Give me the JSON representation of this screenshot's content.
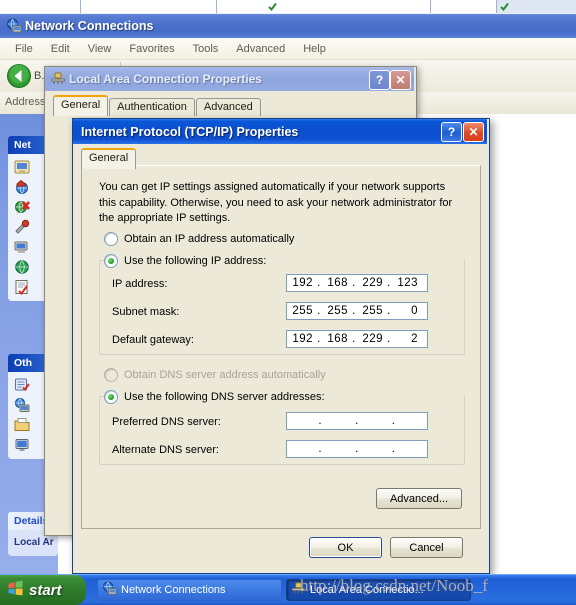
{
  "top_strip": {
    "segments": [
      "",
      "",
      "",
      ""
    ]
  },
  "explorer": {
    "title": "Network Connections",
    "icon": "network-globe-icon",
    "menu": [
      "File",
      "Edit",
      "View",
      "Favorites",
      "Tools",
      "Advanced",
      "Help"
    ],
    "toolbar": {
      "back_label": "B...",
      "back_icon": "back-arrow-icon"
    },
    "address_label": "Address",
    "sidebar": {
      "panels": [
        {
          "title": "Net",
          "full_title": "Network Tasks",
          "icons": [
            "new-connection-icon",
            "home-network-icon",
            "disable-device-icon",
            "repair-icon",
            "rename-icon",
            "view-status-icon",
            "change-settings-icon"
          ]
        },
        {
          "title": "Oth",
          "full_title": "Other Places",
          "icons": [
            "control-panel-icon",
            "my-network-places-icon",
            "my-documents-icon",
            "my-computer-icon"
          ]
        },
        {
          "title": "Details",
          "note": "Local Ar",
          "full_title": "Details"
        }
      ]
    }
  },
  "lac_dialog": {
    "title": "Local Area Connection Properties",
    "icon": "network-adapter-icon",
    "help_button": "?",
    "close_button": "✕",
    "tabs": [
      {
        "label": "General",
        "selected": true
      },
      {
        "label": "Authentication",
        "selected": false
      },
      {
        "label": "Advanced",
        "selected": false
      }
    ]
  },
  "ip_dialog": {
    "title": "Internet Protocol (TCP/IP) Properties",
    "help_button": "?",
    "close_button": "✕",
    "tabs": [
      {
        "label": "General",
        "selected": true
      }
    ],
    "description": "You can get IP settings assigned automatically if your network supports this capability. Otherwise, you need to ask your network administrator for the appropriate IP settings.",
    "ip_section": {
      "auto_option": "Obtain an IP address automatically",
      "manual_option": "Use the following IP address:",
      "selected": "manual",
      "fields": [
        {
          "label": "IP address:",
          "octets": [
            "192",
            "168",
            "229",
            "123"
          ]
        },
        {
          "label": "Subnet mask:",
          "octets": [
            "255",
            "255",
            "255",
            "0"
          ]
        },
        {
          "label": "Default gateway:",
          "octets": [
            "192",
            "168",
            "229",
            "2"
          ]
        }
      ]
    },
    "dns_section": {
      "auto_option": "Obtain DNS server address automatically",
      "auto_disabled": true,
      "manual_option": "Use the following DNS server addresses:",
      "selected": "manual",
      "fields": [
        {
          "label": "Preferred DNS server:",
          "octets": [
            "",
            "",
            "",
            ""
          ]
        },
        {
          "label": "Alternate DNS server:",
          "octets": [
            "",
            "",
            "",
            ""
          ]
        }
      ]
    },
    "advanced_button": "Advanced...",
    "ok_button": "OK",
    "cancel_button": "Cancel"
  },
  "taskbar": {
    "start_label": "start",
    "start_icon": "windows-flag-icon",
    "tasks": [
      {
        "label": "Network Connections",
        "icon": "network-globe-icon",
        "active": false
      },
      {
        "label": "Local Area Connectio...",
        "icon": "network-adapter-icon",
        "active": true
      }
    ]
  },
  "watermark": "http://blog.csdn.net/Noob_f",
  "colors": {
    "active_title": "#0b4ecd",
    "inactive_title": "#8ea6df",
    "dialog_face": "#ece9d8",
    "taskbar": "#2a6fe0",
    "start_green": "#2e7a2a",
    "tab_accent": "#f0a30a",
    "radio_green": "#199619"
  }
}
